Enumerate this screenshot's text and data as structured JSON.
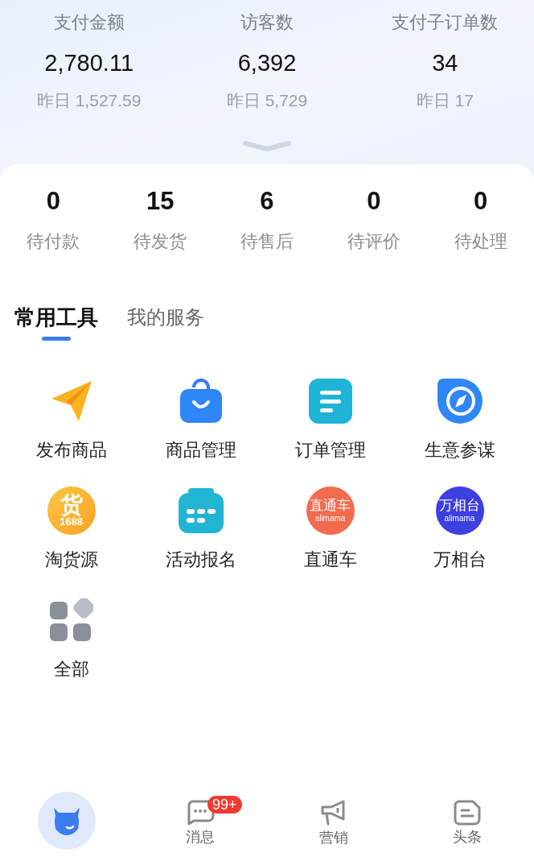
{
  "stats": [
    {
      "label": "支付金额",
      "value": "2,780.11",
      "yesterday": "昨日 1,527.59"
    },
    {
      "label": "访客数",
      "value": "6,392",
      "yesterday": "昨日 5,729"
    },
    {
      "label": "支付子订单数",
      "value": "34",
      "yesterday": "昨日 17"
    }
  ],
  "orders": [
    {
      "count": "0",
      "label": "待付款"
    },
    {
      "count": "15",
      "label": "待发货"
    },
    {
      "count": "6",
      "label": "待售后"
    },
    {
      "count": "0",
      "label": "待评价"
    },
    {
      "count": "0",
      "label": "待处理"
    }
  ],
  "tabs": [
    {
      "label": "常用工具",
      "selected": true
    },
    {
      "label": "我的服务",
      "selected": false
    }
  ],
  "tools": [
    {
      "kind": "plane",
      "label": "发布商品"
    },
    {
      "kind": "bag",
      "label": "商品管理"
    },
    {
      "kind": "doc",
      "label": "订单管理"
    },
    {
      "kind": "compass",
      "label": "生意参谋"
    },
    {
      "kind": "goods",
      "label": "淘货源",
      "logo_text": "货",
      "logo_sub": "1688"
    },
    {
      "kind": "calendar",
      "label": "活动报名"
    },
    {
      "kind": "red",
      "label": "直通车",
      "logo_text": "直通车",
      "logo_sub": "alimama"
    },
    {
      "kind": "blue",
      "label": "万相台",
      "logo_text": "万相台",
      "logo_sub": "alimama"
    },
    {
      "kind": "grid",
      "label": "全部"
    }
  ],
  "nav": [
    {
      "kind": "home",
      "selected": true
    },
    {
      "kind": "chat",
      "label": "消息",
      "badge": "99+",
      "selected": false
    },
    {
      "kind": "megaphone",
      "label": "营销",
      "selected": false
    },
    {
      "kind": "news",
      "label": "头条",
      "selected": false
    }
  ]
}
